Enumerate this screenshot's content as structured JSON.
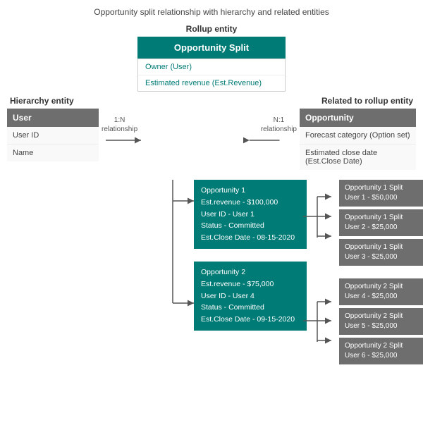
{
  "page": {
    "title": "Opportunity split relationship with hierarchy and related entities"
  },
  "rollup": {
    "section_label": "Rollup entity",
    "header": "Opportunity Split",
    "fields": [
      "Owner (User)",
      "Estimated revenue (Est.Revenue)"
    ]
  },
  "hierarchy": {
    "section_label": "Hierarchy entity",
    "header": "User",
    "fields": [
      "User ID",
      "Name"
    ]
  },
  "related": {
    "section_label": "Related to rollup entity",
    "header": "Opportunity",
    "fields": [
      "Forecast category (Option set)",
      "Estimated close date (Est.Close Date)"
    ]
  },
  "relationship_left": {
    "type": "1:N",
    "label": "relationship"
  },
  "relationship_right": {
    "type": "N:1",
    "label": "relationship"
  },
  "opportunities": [
    {
      "id": "opp1",
      "lines": [
        "Opportunity 1",
        "Est.revenue - $100,000",
        "User ID - User 1",
        "Status - Committed",
        "Est.Close Date - 08-15-2020"
      ],
      "splits": [
        {
          "line1": "Opportunity 1 Split",
          "line2": "User 1 - $50,000"
        },
        {
          "line1": "Opportunity 1 Split",
          "line2": "User 2 - $25,000"
        },
        {
          "line1": "Opportunity 1 Split",
          "line2": "User 3 - $25,000"
        }
      ]
    },
    {
      "id": "opp2",
      "lines": [
        "Opportunity 2",
        "Est.revenue - $75,000",
        "User ID - User 4",
        "Status - Committed",
        "Est.Close Date - 09-15-2020"
      ],
      "splits": [
        {
          "line1": "Opportunity 2 Split",
          "line2": "User 4 - $25,000"
        },
        {
          "line1": "Opportunity 2 Split",
          "line2": "User 5 - $25,000"
        },
        {
          "line1": "Opportunity 2 Split",
          "line2": "User 6 - $25,000"
        }
      ]
    }
  ]
}
